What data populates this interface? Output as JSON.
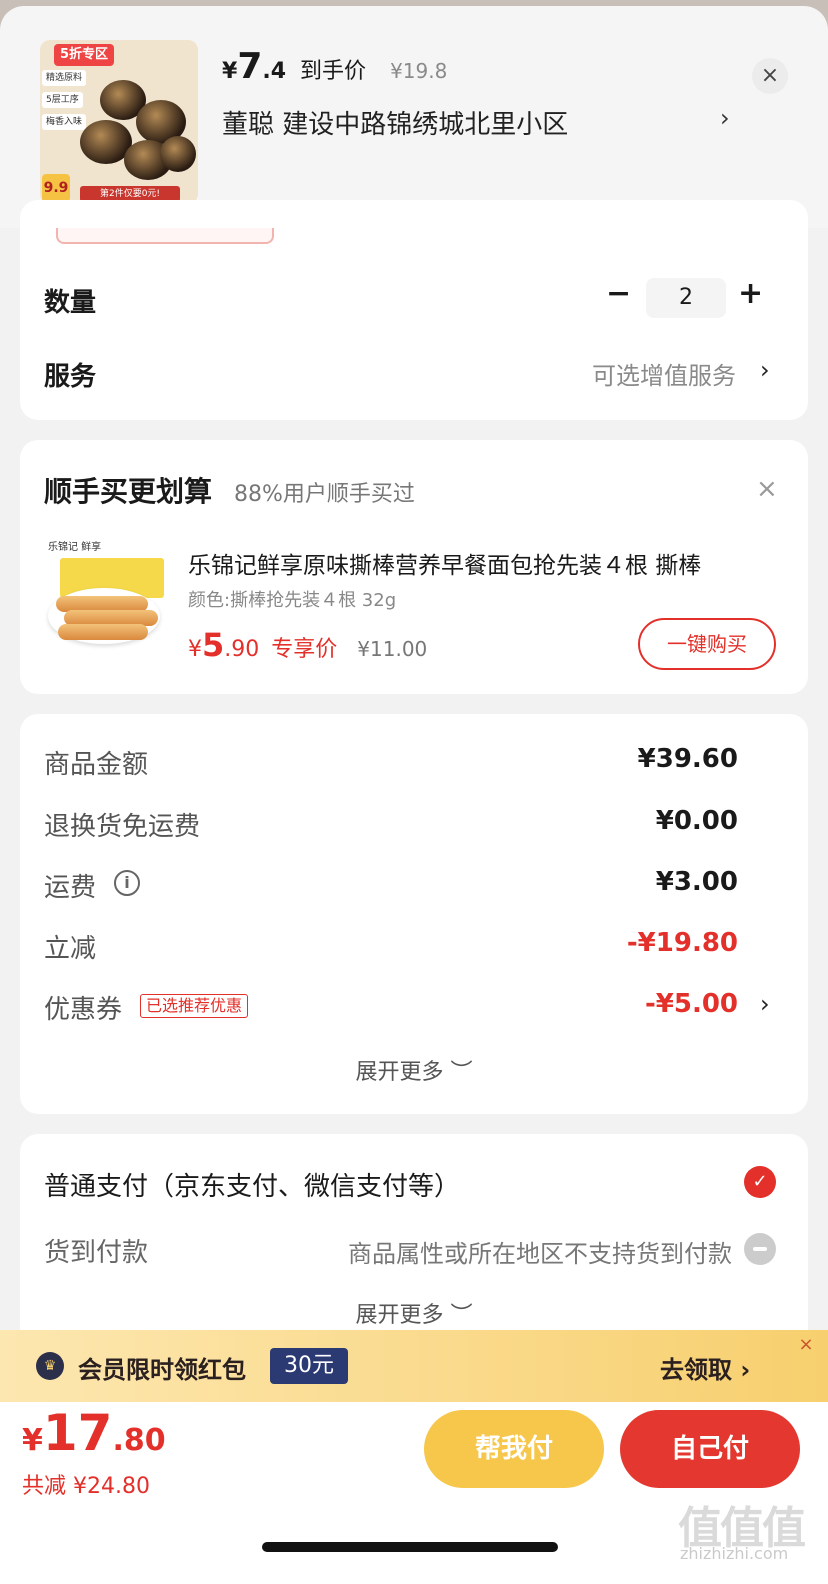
{
  "header": {
    "thumb": {
      "tag": "5折专区",
      "labels": [
        "精选原料",
        "5层工序",
        "梅香入味"
      ],
      "price_badge": "9.9",
      "promo": "第2件仅要0元!"
    },
    "price_currency": "¥",
    "price_int": "7",
    "price_dec": ".4",
    "price_label": "到手价",
    "original_price": "¥19.8",
    "address": "董聪  建设中路锦绣城北里小区",
    "chevron": "›",
    "close": "×"
  },
  "quantity": {
    "label": "数量",
    "minus": "−",
    "value": "2",
    "plus": "+"
  },
  "service": {
    "label": "服务",
    "value": "可选增值服务",
    "chevron": "›"
  },
  "upsell": {
    "title": "顺手买更划算",
    "subtitle": "88%用户顺手买过",
    "close": "×",
    "item": {
      "brand": "乐锦记 鲜享",
      "title": "乐锦记鲜享原味撕棒营养早餐面包抢先装４根 撕棒",
      "attr": "颜色:撕棒抢先装４根 32g",
      "price_currency": "¥",
      "price_int": "5",
      "price_dec": ".90",
      "price_label": "专享价",
      "original_price": "¥11.00",
      "buy_label": "一键购买"
    }
  },
  "summary": {
    "rows": [
      {
        "label": "商品金额",
        "value": "¥39.60"
      },
      {
        "label": "退换货免运费",
        "value": "¥0.00"
      },
      {
        "label": "运费",
        "value": "¥3.00"
      },
      {
        "label": "立减",
        "value": "-¥19.80"
      },
      {
        "label": "优惠券",
        "value": "-¥5.00"
      }
    ],
    "info_icon": "i",
    "coupon_tag": "已选推荐优惠",
    "coupon_chevron": "›",
    "expand": "展开更多 ︶"
  },
  "payment": {
    "normal_label": "普通支付（京东支付、微信支付等）",
    "cod_label": "货到付款",
    "cod_note": "商品属性或所在地区不支持货到付款",
    "check": "✓",
    "expand": "展开更多 ︶"
  },
  "banner": {
    "icon": "♛",
    "text": "会员限时领红包",
    "badge": "30元",
    "cta": "去领取 ›",
    "close": "×"
  },
  "footer": {
    "total_currency": "¥",
    "total_int": "17",
    "total_dec": ".80",
    "saved": "共减 ¥24.80",
    "help_pay": "帮我付",
    "self_pay": "自己付"
  },
  "watermark": {
    "text": "值值值",
    "sub": "zhizhizhi.com"
  },
  "colors": {
    "accent": "#e3302a",
    "help_button": "#f6c74b",
    "banner_badge": "#2c3a74"
  }
}
